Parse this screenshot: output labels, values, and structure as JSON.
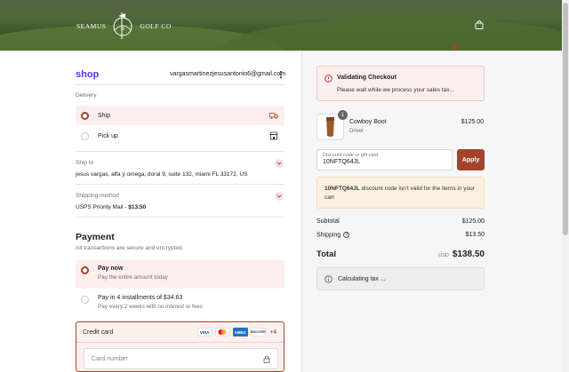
{
  "header": {
    "brand_left": "SEAMUS",
    "brand_right": "GOLF CO"
  },
  "account": {
    "shop_logo": "shop",
    "email": "vargasmartinezjesusantonio6@gmail.com"
  },
  "delivery": {
    "label": "Delivery",
    "options": [
      {
        "label": "Ship",
        "selected": true,
        "icon": "truck-icon"
      },
      {
        "label": "Pick up",
        "selected": false,
        "icon": "store-icon"
      }
    ]
  },
  "ship_to": {
    "label": "Ship to",
    "value": "jesus vargas, alfa y omega, doral 9, suite 132, miami FL 33172, US"
  },
  "shipping_method": {
    "label": "Shipping method",
    "name": "USPS Priority Mail - ",
    "price": "$13.50"
  },
  "payment": {
    "title": "Payment",
    "subtitle": "All transactions are secure and encrypted.",
    "options": [
      {
        "title": "Pay now",
        "subtitle": "Pay the entire amount today",
        "selected": true
      },
      {
        "title": "Pay in 4 installments of $34.63",
        "subtitle": "Pay every 2 weeks with no interest or fees",
        "selected": false
      }
    ],
    "credit_card": {
      "label": "Credit card",
      "brands": [
        "VISA",
        "",
        "AMEX",
        "DISCOVER"
      ],
      "more": "+4",
      "card_number_placeholder": "Card number"
    }
  },
  "alert": {
    "title": "Validating Checkout",
    "message": "Please wait while we process your sales tax..."
  },
  "cart": {
    "item": {
      "qty": "1",
      "name": "Cowboy Boot",
      "variant": "Driver",
      "price": "$125.00"
    }
  },
  "discount": {
    "placeholder": "Discount code or gift card",
    "value": "10NFTQ64JL",
    "apply_label": "Apply",
    "warning_code": "10NFTQ64JL",
    "warning_text": " discount code isn't valid for the items in your cart"
  },
  "summary": {
    "subtotal_label": "Subtotal",
    "subtotal_value": "$125.00",
    "shipping_label": "Shipping",
    "shipping_value": "$13.50",
    "total_label": "Total",
    "currency": "USD",
    "total_value": "$138.50",
    "tax_status": "Calculating tax ..."
  },
  "colors": {
    "accent": "#a2432b",
    "shop_purple": "#5a31f4",
    "selected_bg": "#fdeeee"
  }
}
